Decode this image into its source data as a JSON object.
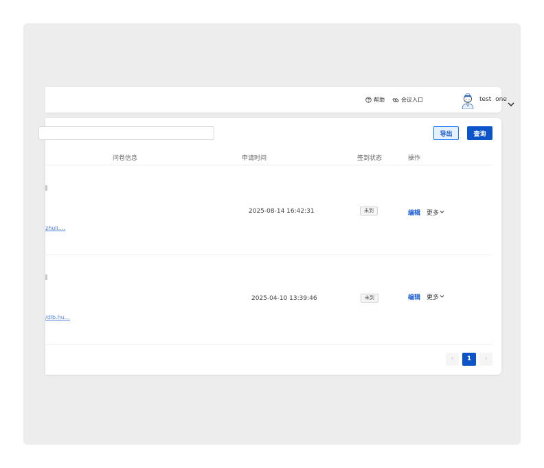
{
  "header": {
    "help_label": "帮助",
    "meeting_entry_label": "会议入口",
    "username": "test one"
  },
  "toolbar": {
    "search_value": "",
    "export_label": "导出",
    "query_label": "查询"
  },
  "table": {
    "columns": [
      "问卷信息",
      "申请时间",
      "签到状态",
      "操作"
    ],
    "rows": [
      {
        "link_fragment": "zhuli.…",
        "time": "2025-08-14 16:42:31",
        "status": "未到",
        "edit_label": "编辑",
        "more_label": "更多"
      },
      {
        "link_fragment": "/dlb.hu…",
        "time": "2025-04-10 13:39:46",
        "status": "未到",
        "edit_label": "编辑",
        "more_label": "更多"
      }
    ]
  },
  "pagination": {
    "prev": "‹",
    "current": "1",
    "next": "›"
  },
  "icons": {
    "help": "question-circle-icon",
    "meeting": "link-icon",
    "user_menu": "chevron-down-icon"
  },
  "colors": {
    "primary": "#0b54c9",
    "link": "#1f5fd0",
    "frame_bg": "#ededed"
  }
}
